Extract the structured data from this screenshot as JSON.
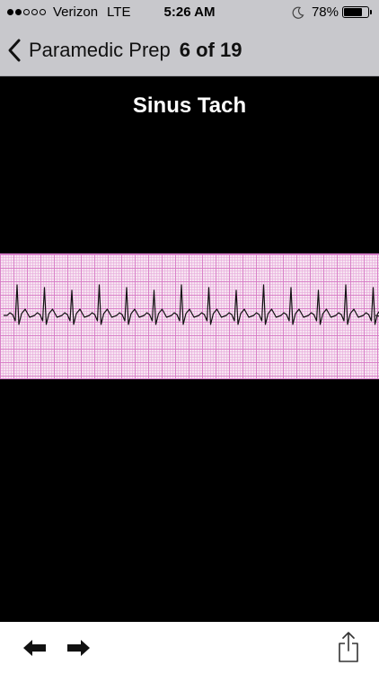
{
  "status_bar": {
    "carrier": "Verizon",
    "network": "LTE",
    "time": "5:26 AM",
    "battery_percent": "78%",
    "battery_level": 0.78,
    "signal_bars_filled": 2,
    "signal_bars_total": 5
  },
  "nav": {
    "back_label": "Paramedic Prep",
    "counter": "6 of 19"
  },
  "card": {
    "title": "Sinus Tach",
    "rhythm_image": "ecg-rhythm-strip"
  },
  "toolbar": {
    "prev_icon": "arrow-left-icon",
    "next_icon": "arrow-right-icon",
    "share_icon": "share-icon"
  },
  "colors": {
    "header_bg": "#c8c8cc",
    "background": "#000000",
    "strip_bg": "#f7e4f1",
    "grid_line": "#d678c4",
    "trace": "#111111"
  }
}
